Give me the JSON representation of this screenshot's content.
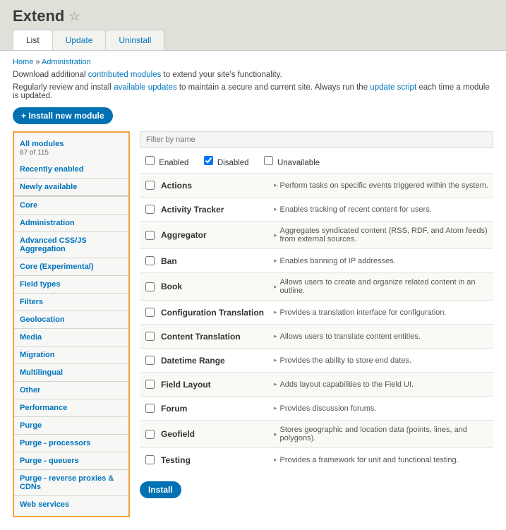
{
  "page_title": "Extend",
  "tabs": {
    "list": "List",
    "update": "Update",
    "uninstall": "Uninstall"
  },
  "breadcrumb": {
    "home": "Home",
    "admin": "Administration",
    "sep": " » "
  },
  "help1_pre": "Download additional ",
  "help1_link": "contributed modules",
  "help1_post": " to extend your site's functionality.",
  "help2_pre": "Regularly review and install ",
  "help2_link1": "available updates",
  "help2_mid": " to maintain a secure and current site. Always run the ",
  "help2_link2": "update script",
  "help2_post": " each time a module is updated.",
  "install_new": "+ Install new module",
  "sidebar": {
    "all": "All modules",
    "count": "87 of 115",
    "items": [
      "Recently enabled",
      "Newly available",
      "__divider__",
      "Core",
      "Administration",
      "Advanced CSS/JS Aggregation",
      "Core (Experimental)",
      "Field types",
      "Filters",
      "Geolocation",
      "Media",
      "Migration",
      "Multilingual",
      "Other",
      "Performance",
      "Purge",
      "Purge - processors",
      "Purge - queuers",
      "Purge - reverse proxies & CDNs",
      "Web services"
    ]
  },
  "filter_placeholder": "Filter by name",
  "status": {
    "enabled": "Enabled",
    "disabled": "Disabled",
    "unavailable": "Unavailable"
  },
  "modules": [
    {
      "name": "Actions",
      "desc": "Perform tasks on specific events triggered within the system."
    },
    {
      "name": "Activity Tracker",
      "desc": "Enables tracking of recent content for users."
    },
    {
      "name": "Aggregator",
      "desc": "Aggregates syndicated content (RSS, RDF, and Atom feeds) from external sources."
    },
    {
      "name": "Ban",
      "desc": "Enables banning of IP addresses."
    },
    {
      "name": "Book",
      "desc": "Allows users to create and organize related content in an outline."
    },
    {
      "name": "Configuration Translation",
      "desc": "Provides a translation interface for configuration."
    },
    {
      "name": "Content Translation",
      "desc": "Allows users to translate content entities."
    },
    {
      "name": "Datetime Range",
      "desc": "Provides the ability to store end dates."
    },
    {
      "name": "Field Layout",
      "desc": "Adds layout capabilities to the Field UI."
    },
    {
      "name": "Forum",
      "desc": "Provides discussion forums."
    },
    {
      "name": "Geofield",
      "desc": "Stores geographic and location data (points, lines, and polygons)."
    },
    {
      "name": "Testing",
      "desc": "Provides a framework for unit and functional testing."
    }
  ],
  "install_btn": "Install"
}
